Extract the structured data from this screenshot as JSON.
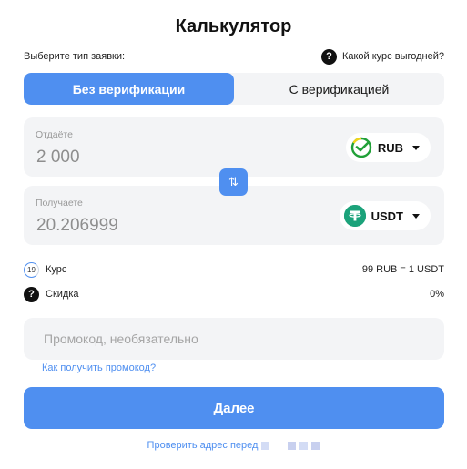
{
  "title": "Калькулятор",
  "type_label": "Выберите тип заявки:",
  "help": {
    "icon": "question-icon",
    "label": "Какой курс выгодней?"
  },
  "tabs": [
    {
      "label": "Без верификации",
      "active": true
    },
    {
      "label": "С верификацией",
      "active": false
    }
  ],
  "give": {
    "label": "Отдаёте",
    "value": "2 000",
    "currency": "RUB",
    "icon": "sberbank-icon"
  },
  "get": {
    "label": "Получаете",
    "value": "20.206999",
    "currency": "USDT",
    "icon": "tether-icon"
  },
  "swap_icon": "swap-arrows-icon",
  "rate": {
    "timer": "19",
    "label": "Курс",
    "value": "99 RUB = 1 USDT"
  },
  "discount": {
    "label": "Скидка",
    "value": "0%"
  },
  "promo": {
    "placeholder": "Промокод, необязательно",
    "link": "Как получить промокод?"
  },
  "next_label": "Далее",
  "check_label": "Проверить адрес перед",
  "colors": {
    "accent": "#4f8ff0",
    "field_bg": "#f3f4f6",
    "usdt": "#1ba27a"
  }
}
